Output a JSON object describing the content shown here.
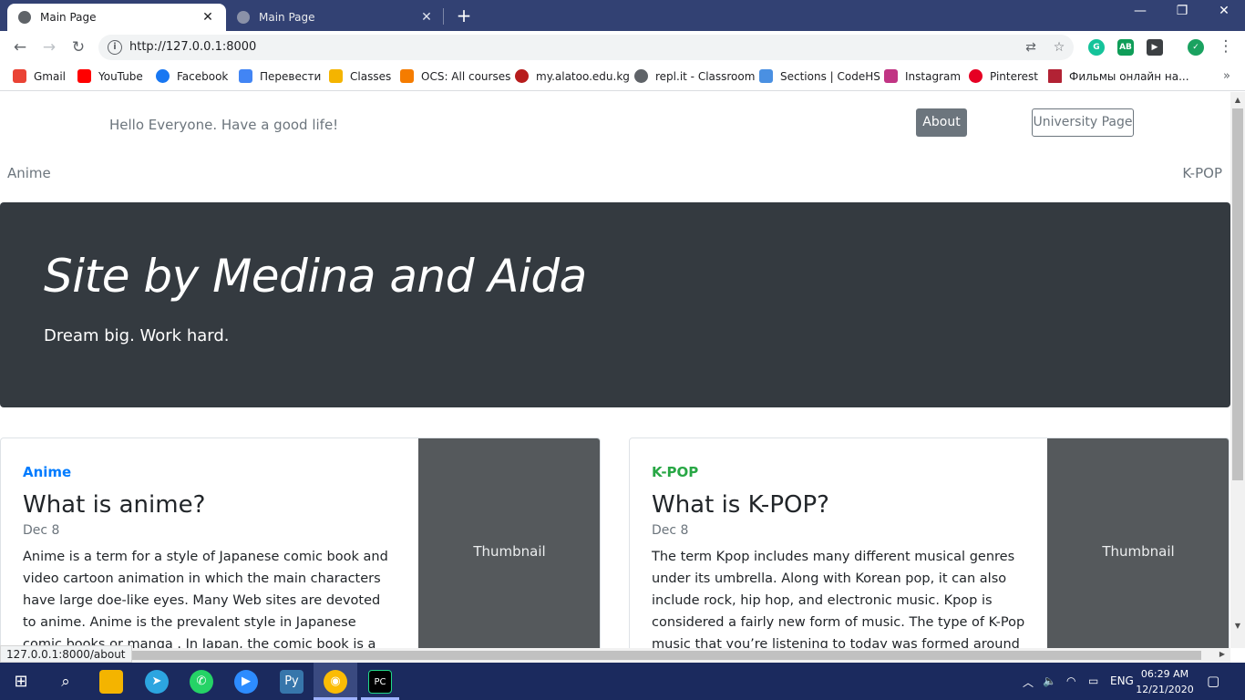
{
  "browser": {
    "tabs": [
      {
        "title": "Main Page",
        "active": true
      },
      {
        "title": "Main Page",
        "active": false
      }
    ],
    "url": "http://127.0.0.1:8000",
    "status_url": "127.0.0.1:8000/about",
    "bookmarks": [
      {
        "label": "Gmail",
        "color": "#ea4335"
      },
      {
        "label": "YouTube",
        "color": "#ff0000"
      },
      {
        "label": "Facebook",
        "color": "#1877f2"
      },
      {
        "label": "Перевести",
        "color": "#4285f4"
      },
      {
        "label": "Classes",
        "color": "#f4b400"
      },
      {
        "label": "OCS: All courses",
        "color": "#f57c00"
      },
      {
        "label": "my.alatoo.edu.kg",
        "color": "#b71c1c"
      },
      {
        "label": "repl.it - Classroom",
        "color": "#5f6368"
      },
      {
        "label": "Sections | CodeHS",
        "color": "#4a90e2"
      },
      {
        "label": "Instagram",
        "color": "#c13584"
      },
      {
        "label": "Pinterest",
        "color": "#e60023"
      },
      {
        "label": "Фильмы онлайн на...",
        "color": "#b22234"
      }
    ]
  },
  "page": {
    "greeting": "Hello Everyone. Have a good life!",
    "about_label": "About",
    "university_label": "University Page",
    "nav_left": "Anime",
    "nav_right": "K-POP",
    "hero_title": "Site by Medina and Aida",
    "hero_subtitle": "Dream big. Work hard.",
    "cards": [
      {
        "category": "Anime",
        "category_color": "#007bff",
        "title": "What is anime?",
        "date": "Dec 8",
        "text": "Anime is a term for a style of Japanese comic book and video cartoon animation in which the main characters have large doe-like eyes. Many Web sites are devoted to anime. Anime is the prevalent style in Japanese comic books or manga . In Japan, the comic book is a popular",
        "thumbnail": "Thumbnail"
      },
      {
        "category": "K-POP",
        "category_color": "#28a745",
        "title": "What is K-POP?",
        "date": "Dec 8",
        "text": "The term Kpop includes many different musical genres under its umbrella. Along with Korean pop, it can also include rock, hip hop, and electronic music. Kpop is considered a fairly new form of music. The type of K-Pop music that you’re listening to today was formed around",
        "thumbnail": "Thumbnail"
      }
    ]
  },
  "taskbar": {
    "language": "ENG",
    "time": "06:29 AM",
    "date": "12/21/2020"
  }
}
